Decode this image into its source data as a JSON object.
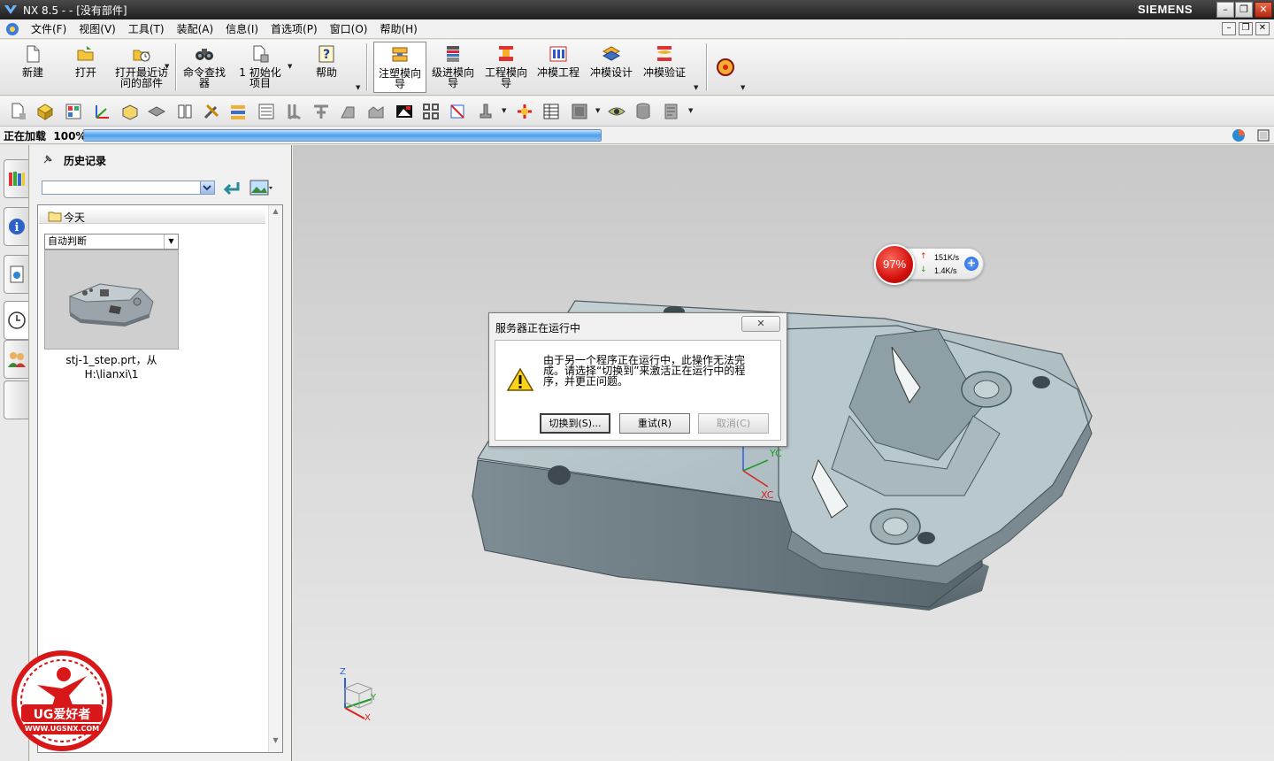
{
  "window": {
    "title": "NX 8.5 -   - [没有部件]",
    "brand": "SIEMENS",
    "controls": {
      "minimize": "–",
      "restore": "❐",
      "close": "✕"
    }
  },
  "menu": {
    "items": [
      "文件(F)",
      "视图(V)",
      "工具(T)",
      "装配(A)",
      "信息(I)",
      "首选项(P)",
      "窗口(O)",
      "帮助(H)"
    ]
  },
  "toolbar": {
    "new": "新建",
    "open": "打开",
    "recent_line1": "打开最近访",
    "recent_line2": "问的部件",
    "cmd_finder_line1": "命令查找",
    "cmd_finder_line2": "器",
    "init_line1": "1  初始化",
    "init_line2": "项目",
    "help": "帮助",
    "mold_wizard_line1": "注塑模向",
    "mold_wizard_line2": "导",
    "prog_die_line1": "级进模向",
    "prog_die_line2": "导",
    "eng_die_line1": "工程模向",
    "eng_die_line2": "导",
    "die_eng": "冲模工程",
    "die_design": "冲模设计",
    "die_validate": "冲模验证"
  },
  "status": {
    "label": "正在加载",
    "percent_text": "100%",
    "progress": 1.0
  },
  "panel": {
    "title": "历史记录",
    "group": "今天",
    "filter": "自动判断",
    "item_line1": "stj-1_step.prt，从",
    "item_line2": "H:\\lianxi\\1"
  },
  "viewport": {
    "axis_yc": "YC",
    "axis_xc": "XC",
    "triad_z": "Z",
    "triad_y": "Y",
    "triad_x": "X"
  },
  "net_widget": {
    "percent": "97%",
    "up_speed": "151K/s",
    "down_speed": "1.4K/s",
    "up_arrow": "↑",
    "down_arrow": "↓",
    "plus": "+"
  },
  "dialog": {
    "title": "服务器正在运行中",
    "close": "✕",
    "message_line1": "由于另一个程序正在运行中，此操作无法完",
    "message_line2": "成。请选择“切换到”来激活正在运行中的程",
    "message_line3": "序，并更正问题。",
    "switch_to": "切换到(S)...",
    "retry": "重试(R)",
    "cancel": "取消(C)"
  },
  "watermark": {
    "brand": "UG爱好者",
    "url": "WWW.UGSNX.COM"
  },
  "colors": {
    "titlebar": "#1e1e1e",
    "progress": "#4f9de8",
    "part": "#a7b8bd",
    "net_red": "#d4110d",
    "watermark_red": "#d81818"
  }
}
